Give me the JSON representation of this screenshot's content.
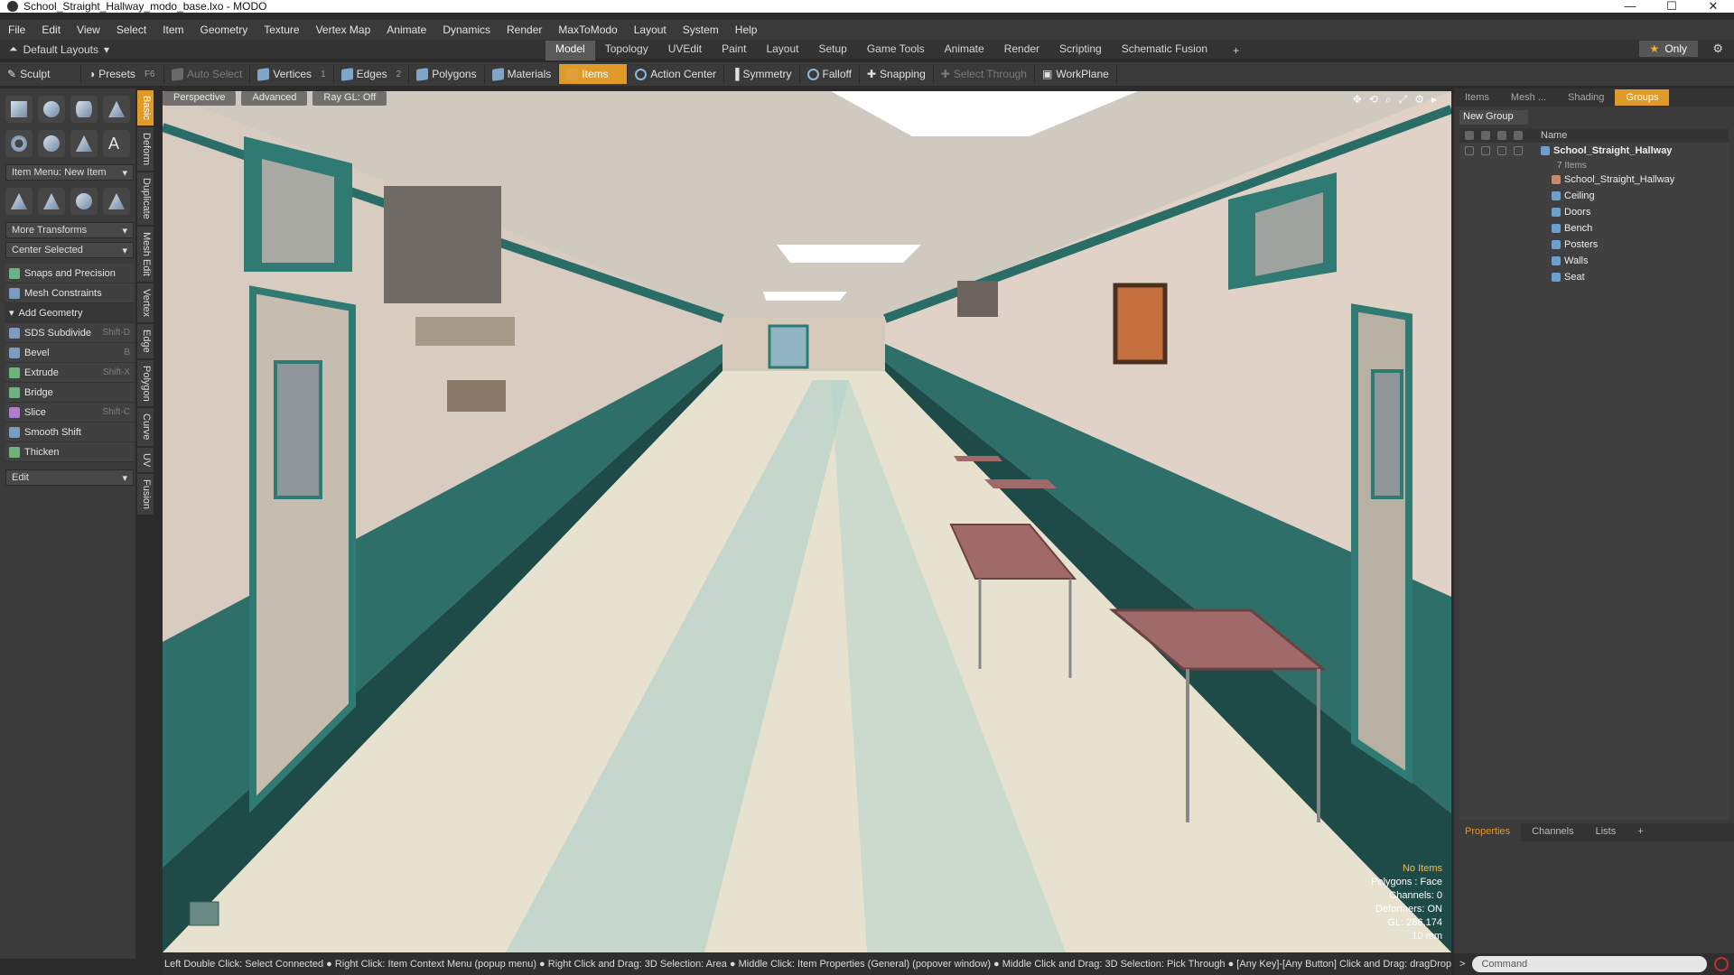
{
  "window": {
    "title": "School_Straight_Hallway_modo_base.lxo - MODO",
    "controls": [
      "—",
      "☐",
      "✕"
    ]
  },
  "menu": [
    "File",
    "Edit",
    "View",
    "Select",
    "Item",
    "Geometry",
    "Texture",
    "Vertex Map",
    "Animate",
    "Dynamics",
    "Render",
    "MaxToModo",
    "Layout",
    "System",
    "Help"
  ],
  "layout_bar": {
    "layouts_label": "Default Layouts",
    "tabs": [
      "Model",
      "Topology",
      "UVEdit",
      "Paint",
      "Layout",
      "Setup",
      "Game Tools",
      "Animate",
      "Render",
      "Scripting",
      "Schematic Fusion"
    ],
    "active_tab": "Model",
    "only_label": "Only"
  },
  "toolbar": {
    "sculpt": "Sculpt",
    "presets": "Presets",
    "presets_key": "F6",
    "auto_select": "Auto Select",
    "vertices": "Vertices",
    "vertices_count": "1",
    "edges": "Edges",
    "edges_count": "2",
    "polygons": "Polygons",
    "materials": "Materials",
    "items": "Items",
    "action_center": "Action Center",
    "symmetry": "Symmetry",
    "falloff": "Falloff",
    "snapping": "Snapping",
    "select_through": "Select Through",
    "workplane": "WorkPlane"
  },
  "left_panel": {
    "item_menu": "Item Menu: New Item",
    "more_transforms": "More Transforms",
    "center_selected": "Center Selected",
    "snaps": "Snaps and Precision",
    "mesh_constraints": "Mesh Constraints",
    "add_geometry": "Add Geometry",
    "tools": [
      {
        "label": "SDS Subdivide",
        "shortcut": "Shift-D"
      },
      {
        "label": "Bevel",
        "shortcut": "B"
      },
      {
        "label": "Extrude",
        "shortcut": "Shift-X"
      },
      {
        "label": "Bridge",
        "shortcut": ""
      },
      {
        "label": "Slice",
        "shortcut": "Shift-C"
      },
      {
        "label": "Smooth Shift",
        "shortcut": ""
      },
      {
        "label": "Thicken",
        "shortcut": ""
      }
    ],
    "edit": "Edit"
  },
  "vertical_tabs": [
    "Basic",
    "Deform",
    "Duplicate",
    "Mesh Edit",
    "Vertex",
    "Edge",
    "Polygon",
    "Curve",
    "UV",
    "Fusion"
  ],
  "viewport": {
    "view_mode": "Perspective",
    "shading": "Advanced",
    "ray_gl": "Ray GL: Off",
    "info": {
      "selection": "No Items",
      "polygons": "Polygons : Face",
      "channels": "Channels: 0",
      "deformers": "Deformers: ON",
      "gl": "GL: 286,174",
      "scale": "10 mm"
    }
  },
  "right_panel": {
    "tabs": [
      "Items",
      "Mesh ...",
      "Shading",
      "Groups"
    ],
    "active_tab": "Groups",
    "new_group": "New Group",
    "column_name": "Name",
    "root": {
      "name": "School_Straight_Hallway",
      "count": "7 Items"
    },
    "items": [
      "School_Straight_Hallway",
      "Ceiling",
      "Doors",
      "Bench",
      "Posters",
      "Walls",
      "Seat"
    ],
    "bottom_tabs": [
      "Properties",
      "Channels",
      "Lists"
    ],
    "bottom_active": "Properties"
  },
  "status_bar": "Left Double Click: Select Connected ● Right Click: Item Context Menu (popup menu) ● Right Click and Drag: 3D Selection: Area ● Middle Click: Item Properties (General) (popover window) ● Middle Click and Drag: 3D Selection: Pick Through ● [Any Key]-[Any Button] Click and Drag: dragDrop...",
  "command_placeholder": "Command",
  "colors": {
    "accent": "#e09a2a",
    "panel": "#3b3b3b",
    "wall_trim": "#2f7a72"
  }
}
